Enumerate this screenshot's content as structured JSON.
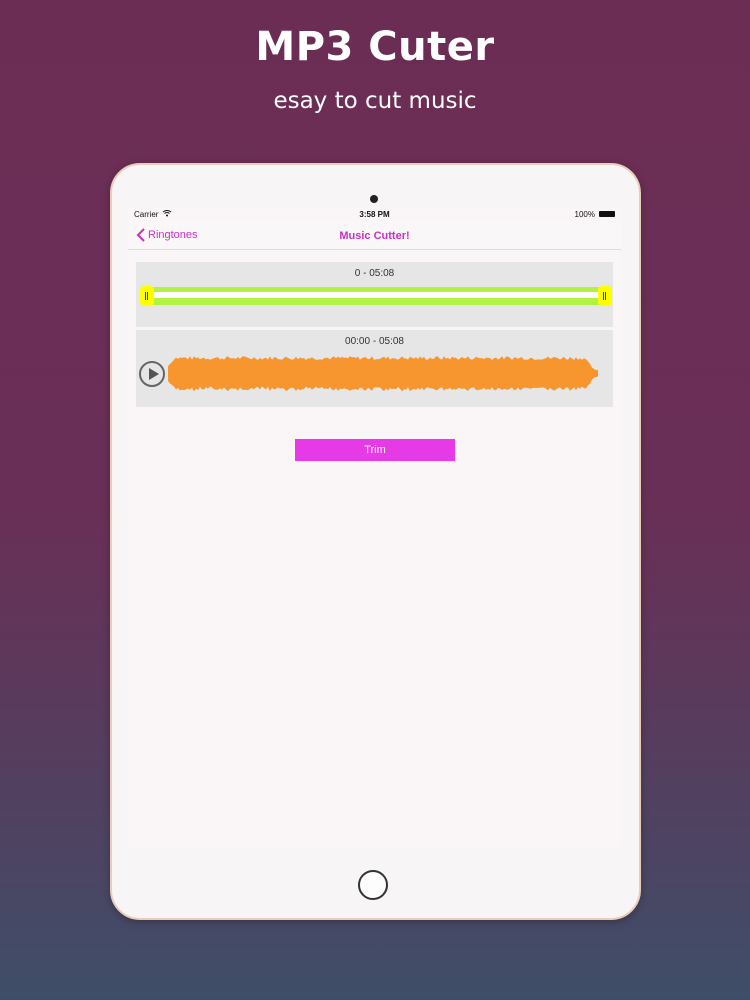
{
  "promo": {
    "title": "MP3 Cuter",
    "subtitle": "esay to cut music"
  },
  "status_bar": {
    "carrier": "Carrier",
    "time": "3:58 PM",
    "battery": "100%"
  },
  "nav": {
    "back_label": "Ringtones",
    "title": "Music Cutter!"
  },
  "range": {
    "label": "0  -  05:08",
    "start_fraction": 0.0,
    "end_fraction": 1.0
  },
  "waveform_panel": {
    "label": "00:00 - 05:08"
  },
  "actions": {
    "trim_label": "Trim"
  },
  "colors": {
    "accent": "#c830c8",
    "trim_button": "#e63ae6",
    "range_track": "#b3f243",
    "handle": "#ffff00",
    "waveform": "#f7962f",
    "background_top": "#6c2d55",
    "background_bottom": "#3f4e68"
  },
  "icons": [
    "wifi-icon",
    "battery-icon",
    "chevron-left-icon",
    "play-icon"
  ]
}
